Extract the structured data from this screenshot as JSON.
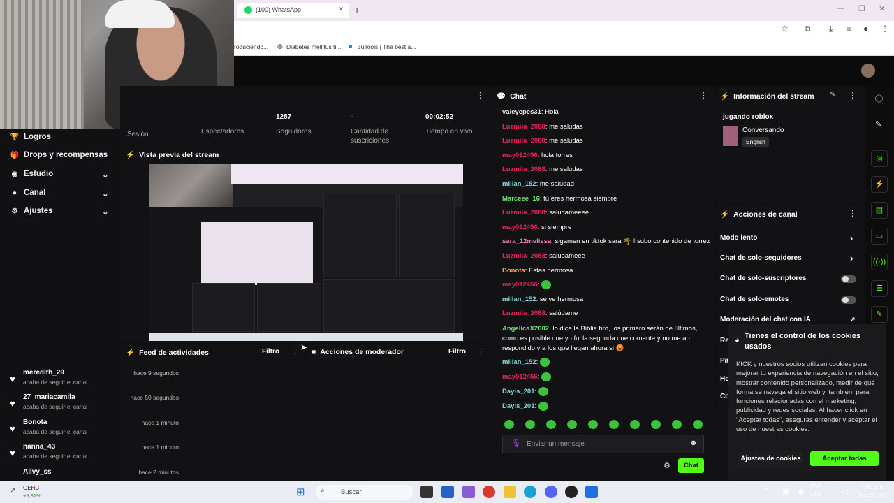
{
  "browser": {
    "tab_title": "(100) WhatsApp",
    "bookmarks": [
      "roduciendo...",
      "Diabetes mellitus ti...",
      "3uTools | The best a..."
    ]
  },
  "sidebar": {
    "items": [
      {
        "label": "Logros",
        "icon": "trophy-icon",
        "chevron": false
      },
      {
        "label": "Drops y recompensas",
        "icon": "gift-icon",
        "chevron": false
      },
      {
        "label": "Estudio",
        "icon": "broadcast-icon",
        "chevron": true
      },
      {
        "label": "Canal",
        "icon": "user-icon",
        "chevron": true
      },
      {
        "label": "Ajustes",
        "icon": "gear-icon",
        "chevron": true
      }
    ]
  },
  "stats": {
    "items": [
      {
        "value": "",
        "label": "Sesión"
      },
      {
        "value": "",
        "label": "Espectadores"
      },
      {
        "value": "1287",
        "label": "Seguidores"
      },
      {
        "value": "-",
        "label": "Cantidad de suscriciones"
      },
      {
        "value": "00:02:52",
        "label": "Tiempo en vivo"
      }
    ]
  },
  "preview": {
    "title": "Vista previa del stream"
  },
  "feed": {
    "title": "Feed de actividades",
    "filter": "Filtro",
    "items": [
      {
        "name": "meredith_29",
        "sub": "acaba de seguir el canal",
        "time": "hace 9 segundos"
      },
      {
        "name": "27_mariacamila",
        "sub": "acaba de seguir el canal",
        "time": "hace 50 segundos"
      },
      {
        "name": "Bonota",
        "sub": "acaba de seguir el canal",
        "time": "hace 1 minuto"
      },
      {
        "name": "nanna_43",
        "sub": "acaba de seguir el canal",
        "time": "hace 1 minuto"
      },
      {
        "name": "Allvy_ss",
        "sub": "",
        "time": "hace 2 minutos"
      }
    ]
  },
  "moderator": {
    "title": "Acciones de moderador",
    "filter": "Filtro"
  },
  "chat": {
    "title": "Chat",
    "input_placeholder": "Enviar un mensaje",
    "send_label": "Chat",
    "messages": [
      {
        "user": "valeyepes31",
        "text": "Hola",
        "color": "#e6e6e6",
        "emote": false
      },
      {
        "user": "Luzmila_2088",
        "text": "me saludas",
        "color": "#e0245e",
        "emote": false
      },
      {
        "user": "Luzmila_2088",
        "text": "me saludas",
        "color": "#e0245e",
        "emote": false
      },
      {
        "user": "may012456",
        "text": "hola torres",
        "color": "#e0245e",
        "emote": false
      },
      {
        "user": "Luzmila_2088",
        "text": "me saludas",
        "color": "#e0245e",
        "emote": false
      },
      {
        "user": "millan_152",
        "text": "me saludad",
        "color": "#7ed7d7",
        "emote": false
      },
      {
        "user": "Marceee_16",
        "text": "tú eres hermosa siempre",
        "color": "#6fdc6f",
        "emote": false
      },
      {
        "user": "Luzmila_2088",
        "text": "saludameeee",
        "color": "#e0245e",
        "emote": false
      },
      {
        "user": "may012456",
        "text": "si siempre",
        "color": "#e0245e",
        "emote": false
      },
      {
        "user": "sara_12melissa",
        "text": "sigamen en tiktok sara 🌴 ! subo contenido de torrez",
        "color": "#e87ab3",
        "emote": false
      },
      {
        "user": "Luzmila_2088",
        "text": "saludameee",
        "color": "#e0245e",
        "emote": false
      },
      {
        "user": "Bonota",
        "text": "Estas hermosa",
        "color": "#f2a65a",
        "emote": false
      },
      {
        "user": "may012456",
        "text": "",
        "color": "#e0245e",
        "emote": true
      },
      {
        "user": "millan_152",
        "text": "se ve hermosa",
        "color": "#7ed7d7",
        "emote": false
      },
      {
        "user": "Luzmila_2088",
        "text": "salúdame",
        "color": "#e0245e",
        "emote": false
      }
    ],
    "long_message": {
      "user": "AngelicaX2002",
      "text": "lo dice la Biblia bro, los primero serán de últimos, como es posible que yo fui la segunda que comente y no me ah respondido y a los que llegan ahora si 😡",
      "color": "#6fdc6f"
    },
    "tail_messages": [
      {
        "user": "millan_152",
        "color": "#7ed7d7"
      },
      {
        "user": "may012456",
        "color": "#e0245e"
      },
      {
        "user": "Dayis_201",
        "color": "#7ed7d7"
      },
      {
        "user": "Dayis_201",
        "color": "#7ed7d7"
      }
    ]
  },
  "stream_info": {
    "title": "Información del stream",
    "stream_title": "jugando roblox",
    "category": "Conversando",
    "language": "English"
  },
  "channel_actions": {
    "title": "Acciones de canal",
    "items": [
      {
        "label": "Modo lento",
        "control": "arrow"
      },
      {
        "label": "Chat de solo-seguidores",
        "control": "arrow"
      },
      {
        "label": "Chat de solo-suscriptores",
        "control": "toggle"
      },
      {
        "label": "Chat de solo-emotes",
        "control": "toggle"
      },
      {
        "label": "Moderación del chat con IA",
        "control": "external"
      }
    ],
    "cut_labels": [
      "Re",
      "Pa",
      "Ho",
      "Co"
    ]
  },
  "cookie": {
    "title": "Tienes el control de los cookies usados",
    "body": "KICK y nuestros socios utilizan cookies para mejorar tu experiencia de navegación en el sitio, mostrar contenido personalizado, medir de qué forma se navega el sitio web y, también, para funciones relacionadas con el marketing, publicidad y redes sociales. Al hacer click en \"Aceptar todas\", aseguras entender y aceptar el uso de nuestras cookies.",
    "settings_label": "Ajustes de cookies",
    "accept_label": "Aceptar todas"
  },
  "taskbar": {
    "weather_title": "GEHC",
    "weather_sub": "+5,81%",
    "search_placeholder": "Buscar",
    "lang": "ESP",
    "region": "LAA",
    "time": "7:01 p. m.",
    "date": "16/12/2025"
  },
  "colors": {
    "accent": "#53fc18",
    "panel": "#121214",
    "background": "#0f0f10"
  }
}
